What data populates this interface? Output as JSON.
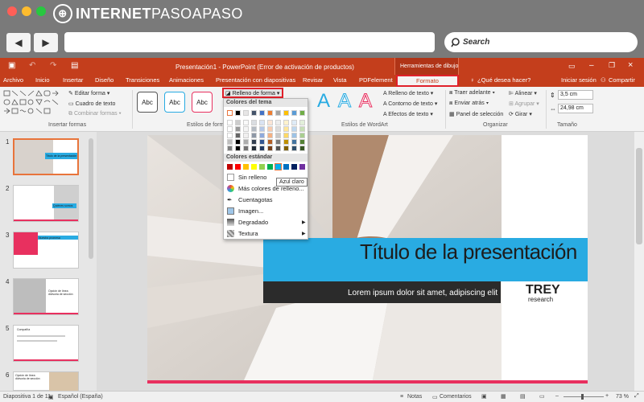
{
  "browser": {
    "logo_prefix": "INTERNET",
    "logo_suffix": "PASOAPASO",
    "back_icon": "◀",
    "forward_icon": "▶",
    "search_label": "Search"
  },
  "window": {
    "title": "Presentación1 - PowerPoint (Error de activación de productos)",
    "tools_label": "Herramientas de dibujo"
  },
  "menu": [
    "Archivo",
    "Inicio",
    "Insertar",
    "Diseño",
    "Transiciones",
    "Animaciones",
    "Presentación con diapositivas",
    "Revisar",
    "Vista",
    "PDFelement"
  ],
  "menu_active": "Formato",
  "menu_help": "¿Qué desea hacer?",
  "menu_signin": "Iniciar sesión",
  "menu_share": "Compartir",
  "ribbon": {
    "insert_shapes": {
      "edit": "Editar forma",
      "textbox": "Cuadro de texto",
      "combine": "Combinar formas",
      "group": "Insertar formas"
    },
    "shape_styles": {
      "sample": "Abc",
      "group": "Estilos de forma",
      "fill_button": "Relleno de forma"
    },
    "wordart": {
      "fill": "Relleno de texto",
      "outline": "Contorno de texto",
      "effects": "Efectos de texto",
      "group": "Estilos de WordArt",
      "sample": "A"
    },
    "arrange": {
      "forward": "Traer adelante",
      "backward": "Enviar atrás",
      "selection": "Panel de selección",
      "align": "Alinear",
      "group_btn": "Agrupar",
      "rotate": "Girar",
      "group": "Organizar"
    },
    "size": {
      "height": "3,5 cm",
      "width": "24,98 cm",
      "group": "Tamaño"
    }
  },
  "dropdown": {
    "theme_header": "Colores del tema",
    "standard_header": "Colores estándar",
    "tooltip": "Azul claro",
    "items": [
      "Sin relleno",
      "Más colores de relleno...",
      "Cuentagotas",
      "Imagen...",
      "Degradado",
      "Textura"
    ],
    "theme_colors": [
      "#ffffff",
      "#000000",
      "#e7e6e6",
      "#44546a",
      "#4472c4",
      "#ed7d31",
      "#a5a5a5",
      "#ffc000",
      "#5b9bd5",
      "#70ad47"
    ],
    "standard_colors": [
      "#c00000",
      "#ff0000",
      "#ffc000",
      "#ffff00",
      "#92d050",
      "#00b050",
      "#00b0f0",
      "#0070c0",
      "#002060",
      "#7030a0"
    ]
  },
  "slide": {
    "title": "Título de la presentación",
    "subtitle": "Lorem ipsum dolor sit amet, adipiscing elit",
    "brand_top": "TREY",
    "brand_bottom": "research"
  },
  "thumbnails": [
    "1",
    "2",
    "3",
    "4",
    "5",
    "6"
  ],
  "thumb_labels": {
    "t1": "Título de la presentación",
    "t2": "Quiénes somos",
    "t3": "Nuestra promesa",
    "t4": "Opción de línea divisoria de sección",
    "t5": "Compañía",
    "t6": "Opción de línea divisoria de sección"
  },
  "status": {
    "slide_info": "Diapositiva 1 de 11",
    "language": "Español (España)",
    "notes": "Notas",
    "comments": "Comentarios",
    "zoom": "73 %"
  },
  "colors": {
    "accent": "#c43e1c",
    "slide_blue": "#29abe2",
    "slide_dark": "#2b2b2b",
    "slide_pink": "#e8305f"
  }
}
